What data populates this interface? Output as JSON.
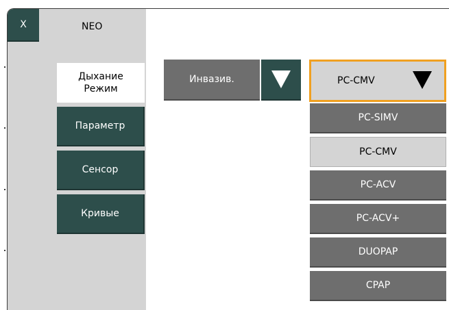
{
  "header": {
    "close_label": "X",
    "title": "NEO"
  },
  "sidebar": {
    "items": [
      {
        "label": "Дыхание\nРежим",
        "active": true
      },
      {
        "label": "Параметр",
        "active": false
      },
      {
        "label": "Сенсор",
        "active": false
      },
      {
        "label": "Кривые",
        "active": false
      }
    ]
  },
  "mode": {
    "value": "Инвазив."
  },
  "ventilation": {
    "selected": "PC-CMV",
    "options": [
      "PC-SIMV",
      "PC-CMV",
      "PC-ACV",
      "PC-ACV+",
      "DUOPAP",
      "CPAP"
    ]
  },
  "colors": {
    "accent_dark_teal": "#2d4e4b",
    "button_gray": "#6e6e6e",
    "panel_light_gray": "#d4d4d4",
    "highlight_orange": "#f0a020"
  }
}
